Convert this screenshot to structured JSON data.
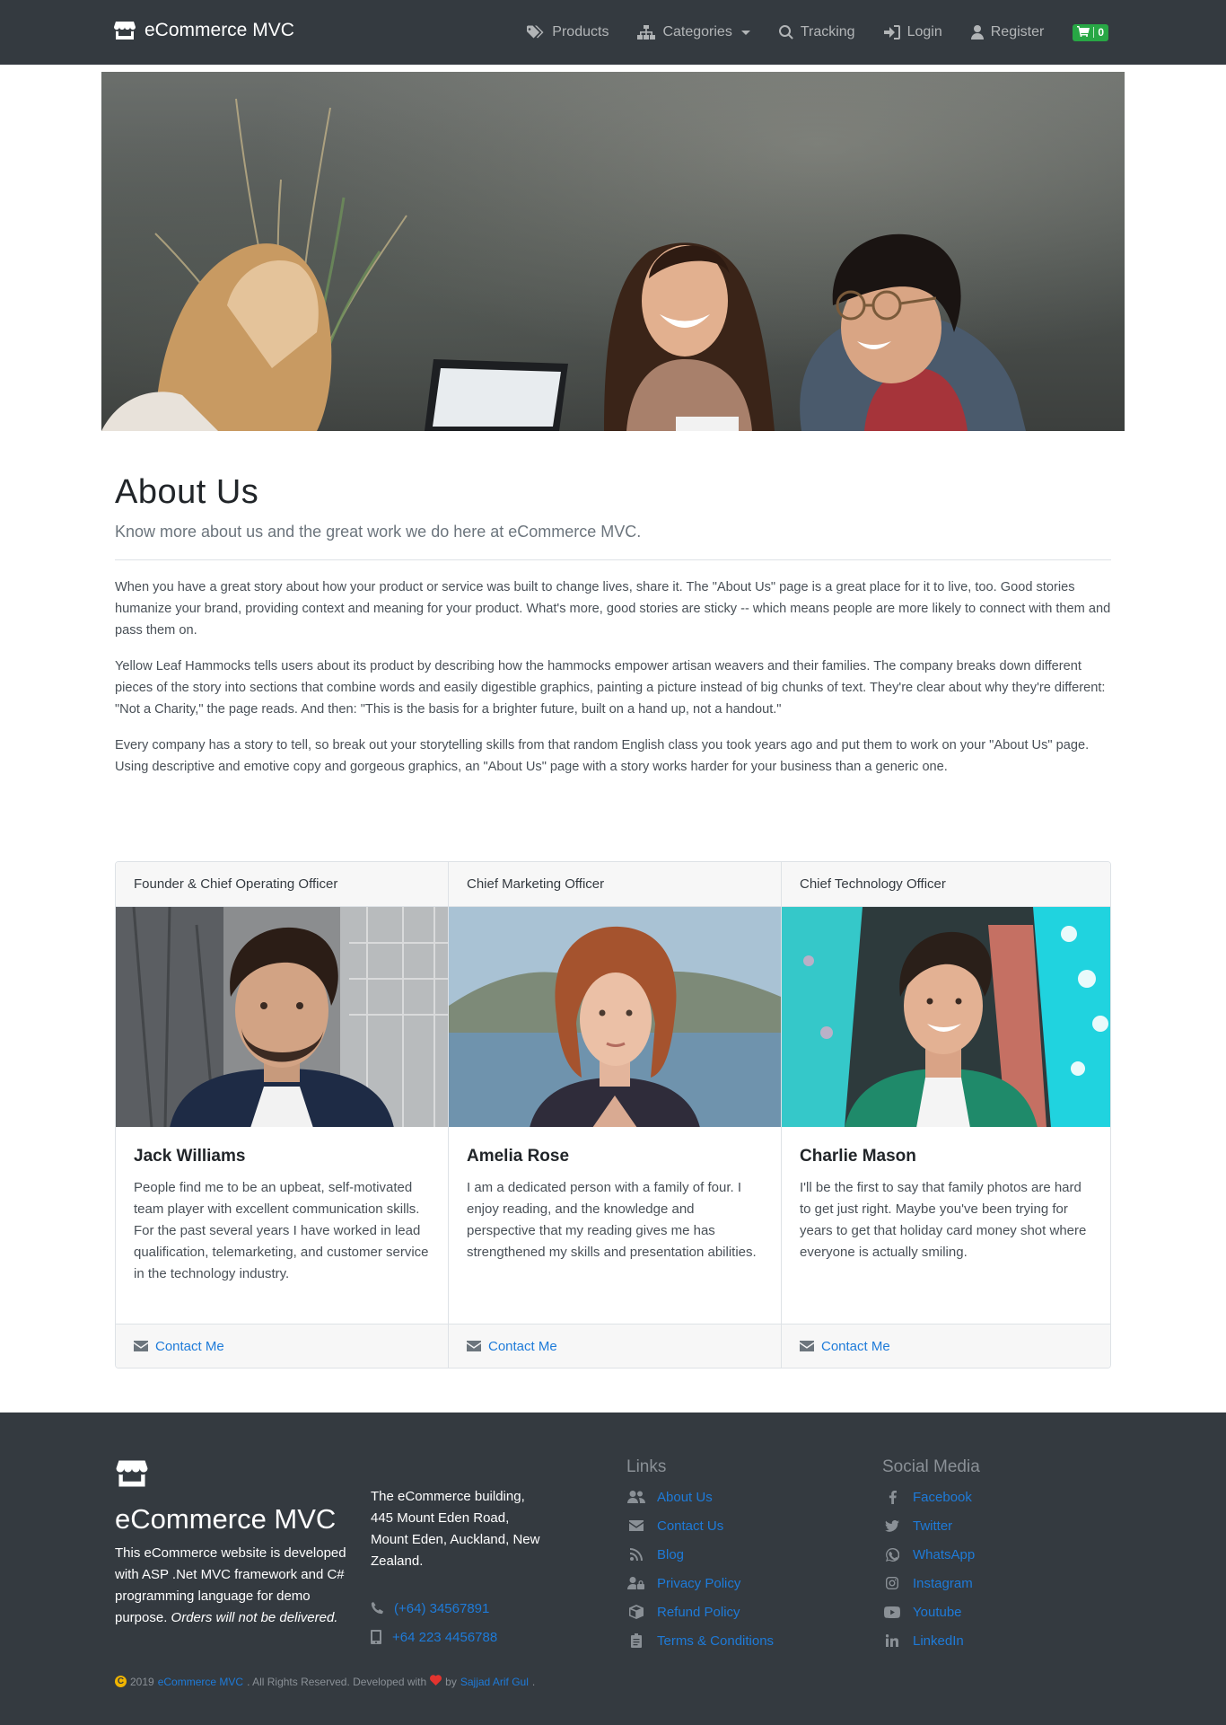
{
  "navbar": {
    "brand": "eCommerce MVC",
    "items": [
      {
        "label": "Products",
        "icon": "tags-icon"
      },
      {
        "label": "Categories",
        "icon": "sitemap-icon"
      },
      {
        "label": "Tracking",
        "icon": "search-icon"
      },
      {
        "label": "Login",
        "icon": "sign-in-icon"
      },
      {
        "label": "Register",
        "icon": "user-icon"
      }
    ],
    "cart_count": "0"
  },
  "about": {
    "title": "About Us",
    "lead": "Know more about us and the great work we do here at eCommerce MVC.",
    "paragraphs": [
      "When you have a great story about how your product or service was built to change lives, share it. The \"About Us\" page is a great place for it to live, too. Good stories humanize your brand, providing context and meaning for your product. What's more, good stories are sticky -- which means people are more likely to connect with them and pass them on.",
      "Yellow Leaf Hammocks tells users about its product by describing how the hammocks empower artisan weavers and their families. The company breaks down different pieces of the story into sections that combine words and easily digestible graphics, painting a picture instead of big chunks of text. They're clear about why they're different: \"Not a Charity,\" the page reads. And then: \"This is the basis for a brighter future, built on a hand up, not a handout.\"",
      "Every company has a story to tell, so break out your storytelling skills from that random English class you took years ago and put them to work on your \"About Us\" page. Using descriptive and emotive copy and gorgeous graphics, an \"About Us\" page with a story works harder for your business than a generic one."
    ]
  },
  "team": [
    {
      "role": "Founder & Chief Operating Officer",
      "name": "Jack Williams",
      "bio": "People find me to be an upbeat, self-motivated team player with excellent communication skills. For the past several years I have worked in lead qualification, telemarketing, and customer service in the technology industry.",
      "contact": "Contact Me"
    },
    {
      "role": "Chief Marketing Officer",
      "name": "Amelia Rose",
      "bio": "I am a dedicated person with a family of four. I enjoy reading, and the knowledge and perspective that my reading gives me has strengthened my skills and presentation abilities.",
      "contact": "Contact Me"
    },
    {
      "role": "Chief Technology Officer",
      "name": "Charlie Mason",
      "bio": "I'll be the first to say that family photos are hard to get just right. Maybe you've been trying for years to get that holiday card money shot where everyone is actually smiling.",
      "contact": "Contact Me"
    }
  ],
  "footer": {
    "brand": "eCommerce MVC",
    "description": "This eCommerce website is developed with ASP .Net MVC framework and C# programming language for demo purpose.",
    "description_note": "Orders will not be delivered.",
    "address": "The eCommerce building, 445 Mount Eden Road, Mount Eden, Auckland, New Zealand.",
    "phone": "(+64) 34567891",
    "mobile": "+64 223 4456788",
    "links_heading": "Links",
    "links": [
      {
        "label": "About Us",
        "icon": "users-icon"
      },
      {
        "label": "Contact Us",
        "icon": "envelope-icon"
      },
      {
        "label": "Blog",
        "icon": "rss-icon"
      },
      {
        "label": "Privacy Policy",
        "icon": "user-lock-icon"
      },
      {
        "label": "Refund Policy",
        "icon": "box-icon"
      },
      {
        "label": "Terms & Conditions",
        "icon": "clipboard-icon"
      }
    ],
    "social_heading": "Social Media",
    "social": [
      {
        "label": "Facebook",
        "icon": "facebook-icon"
      },
      {
        "label": "Twitter",
        "icon": "twitter-icon"
      },
      {
        "label": "WhatsApp",
        "icon": "whatsapp-icon"
      },
      {
        "label": "Instagram",
        "icon": "instagram-icon"
      },
      {
        "label": "Youtube",
        "icon": "youtube-icon"
      },
      {
        "label": "LinkedIn",
        "icon": "linkedin-icon"
      }
    ],
    "copyright": {
      "year": "2019",
      "site": "eCommerce MVC",
      "rights": ". All Rights Reserved. Developed with",
      "by": "by",
      "author": "Sajjad Arif Gul",
      "end": "."
    }
  },
  "colors": {
    "navbar_bg": "#343a40",
    "link": "#1e7bd9",
    "cart_badge": "#28a745",
    "heart": "#e3342f",
    "copyright_icon": "#f0b400"
  }
}
